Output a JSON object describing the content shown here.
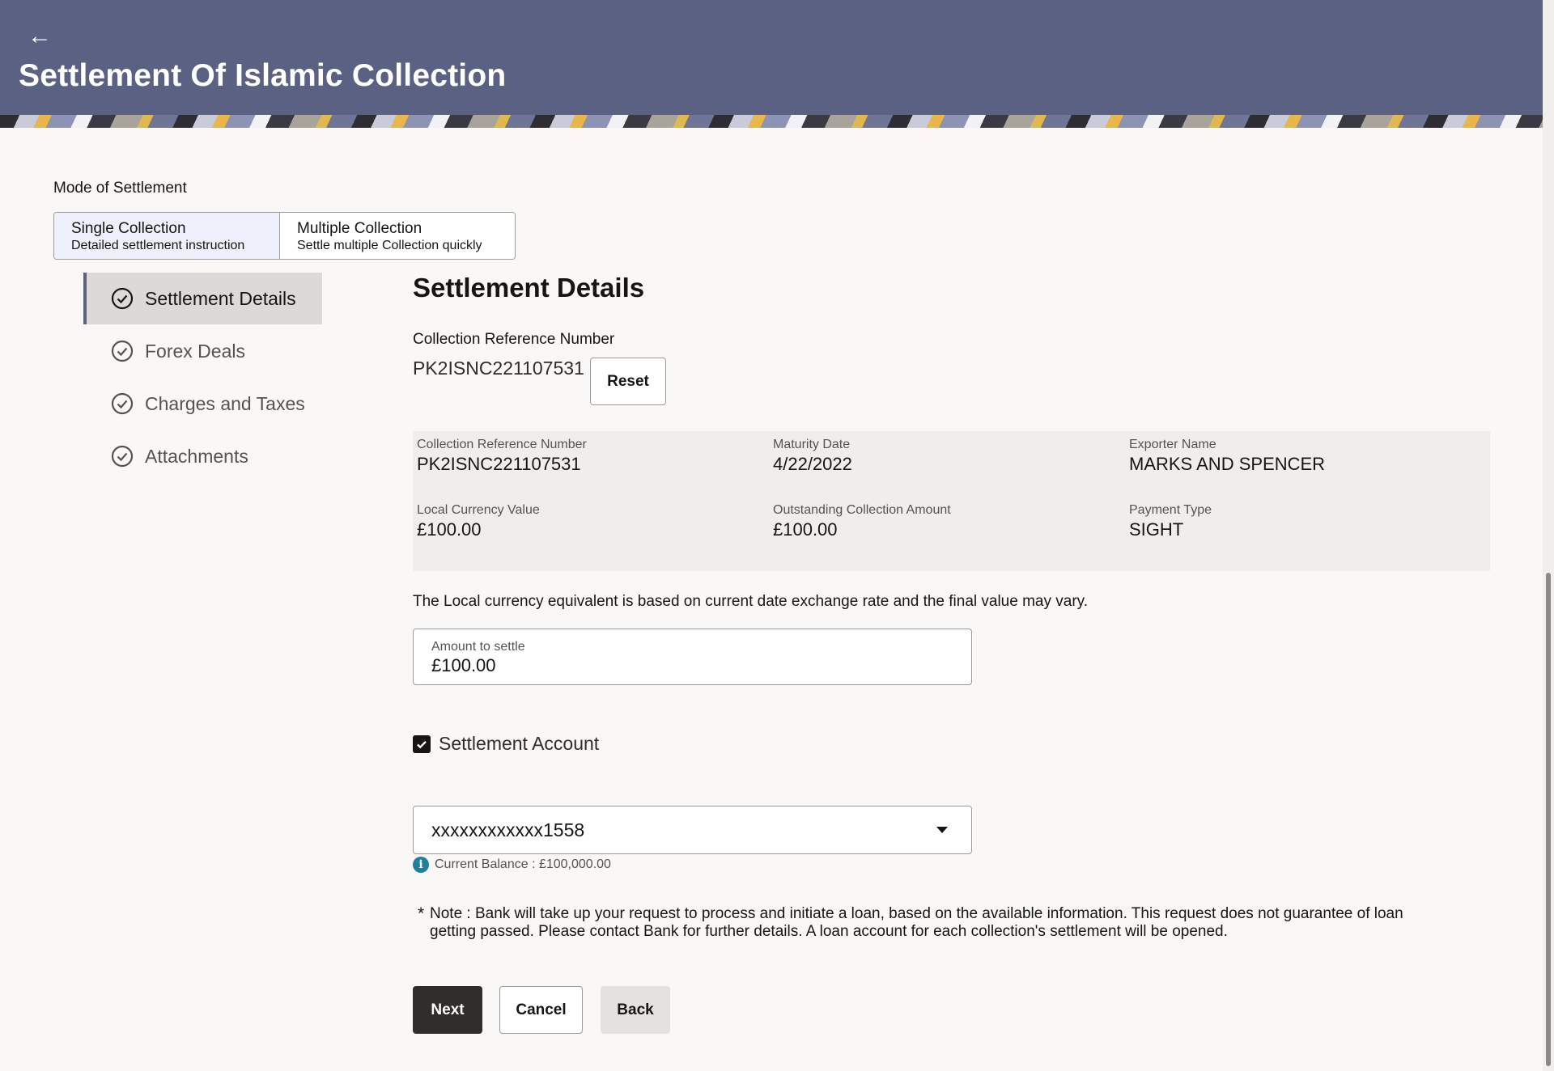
{
  "header": {
    "back_glyph": "←",
    "title": "Settlement Of Islamic Collection"
  },
  "mode": {
    "label": "Mode of Settlement",
    "options": [
      {
        "title": "Single Collection",
        "subtitle": "Detailed settlement instruction",
        "selected": true
      },
      {
        "title": "Multiple Collection",
        "subtitle": "Settle multiple Collection quickly",
        "selected": false
      }
    ]
  },
  "steps": [
    {
      "label": "Settlement Details",
      "active": true
    },
    {
      "label": "Forex Deals",
      "active": false
    },
    {
      "label": "Charges and Taxes",
      "active": false
    },
    {
      "label": "Attachments",
      "active": false
    }
  ],
  "main": {
    "title": "Settlement Details",
    "crn_label": "Collection Reference Number",
    "crn_value": "PK2ISNC221107531",
    "reset_label": "Reset"
  },
  "summary": {
    "items": [
      {
        "label": "Collection Reference Number",
        "value": "PK2ISNC221107531"
      },
      {
        "label": "Maturity Date",
        "value": "4/22/2022"
      },
      {
        "label": "Exporter Name",
        "value": "MARKS AND SPENCER"
      },
      {
        "label": "Local Currency Value",
        "value": "£100.00"
      },
      {
        "label": "Outstanding Collection Amount",
        "value": "£100.00"
      },
      {
        "label": "Payment Type",
        "value": "SIGHT"
      }
    ]
  },
  "rate_note": "The Local currency equivalent is based on current date exchange rate and the final value may vary.",
  "amount": {
    "label": "Amount to settle",
    "value": "£100.00"
  },
  "settlement_account": {
    "checkbox_label": "Settlement Account",
    "checked": true,
    "selected_account": "xxxxxxxxxxxx1558",
    "balance_text": "Current Balance : £100,000.00"
  },
  "loan_note": {
    "star": "*",
    "text": "Note : Bank will take up your request to process and initiate a loan, based on the available information. This request does not guarantee of loan getting passed. Please contact Bank for further details. A loan account for each collection's settlement will be opened."
  },
  "actions": {
    "next": "Next",
    "cancel": "Cancel",
    "back": "Back"
  },
  "colors": {
    "header_bg": "#5a6182",
    "primary_button": "#312d2a",
    "info_icon": "#227e9e"
  }
}
